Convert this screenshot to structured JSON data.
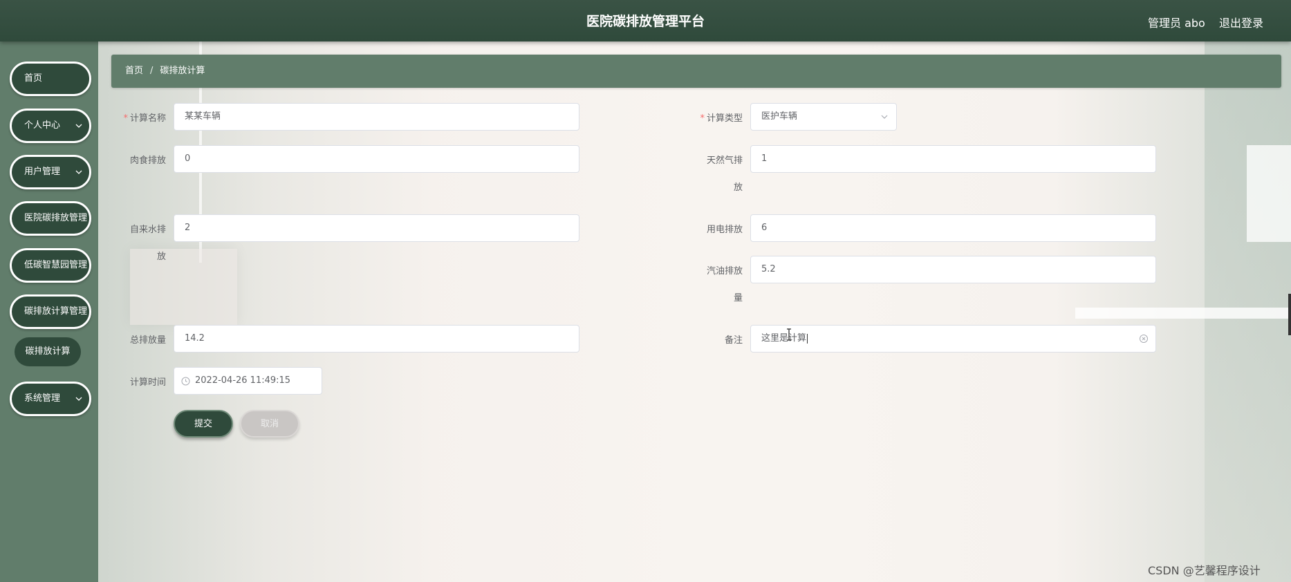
{
  "header": {
    "title": "医院碳排放管理平台",
    "user_label": "管理员 abo",
    "logout_label": "退出登录"
  },
  "sidebar": {
    "items": [
      {
        "label": "首页",
        "has_arrow": false
      },
      {
        "label": "个人中心",
        "has_arrow": true
      },
      {
        "label": "用户管理",
        "has_arrow": true
      },
      {
        "label": "医院碳排放管理",
        "has_arrow": false
      },
      {
        "label": "低碳智慧园管理",
        "has_arrow": false
      },
      {
        "label": "碳排放计算管理",
        "has_arrow": false
      },
      {
        "label": "系统管理",
        "has_arrow": true
      }
    ],
    "sub_item": "碳排放计算"
  },
  "breadcrumb": {
    "home": "首页",
    "separator": "/",
    "current": "碳排放计算"
  },
  "form": {
    "calc_name": {
      "label": "计算名称",
      "value": "某某车辆"
    },
    "calc_type": {
      "label": "计算类型",
      "value": "医护车辆"
    },
    "meat": {
      "label": "肉食排放",
      "value": "0"
    },
    "gas": {
      "label_line1": "天然气排",
      "label_line2": "放",
      "value": "1"
    },
    "water": {
      "label_line1": "自来水排",
      "label_line2": "放",
      "value": "2"
    },
    "electric": {
      "label": "用电排放",
      "value": "6"
    },
    "petrol": {
      "label_line1": "汽油排放",
      "label_line2": "量",
      "value": "5.2"
    },
    "total": {
      "label": "总排放量",
      "value": "14.2"
    },
    "remark": {
      "label": "备注",
      "value": "这里是计算"
    },
    "calc_time": {
      "label": "计算时间",
      "value": "2022-04-26 11:49:15"
    },
    "submit_label": "提交",
    "cancel_label": "取消"
  },
  "watermark": "CSDN @艺馨程序设计",
  "colors": {
    "header_bg": "#2f4a3b",
    "sidebar_bg": "#617d6b",
    "breadcrumb_bg": "#617d6b",
    "menu_bg": "#2f4a3b",
    "required": "#f56c6c"
  }
}
